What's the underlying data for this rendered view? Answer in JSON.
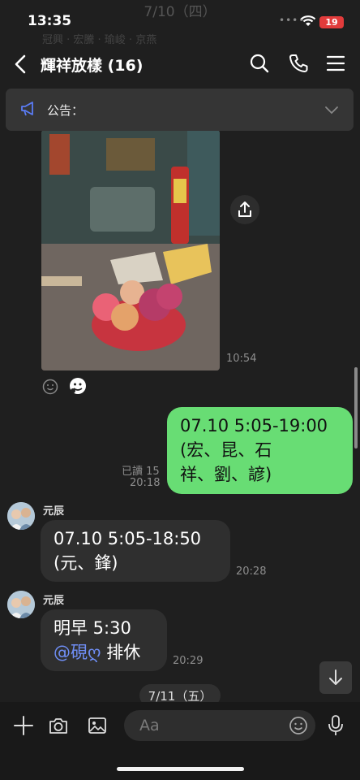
{
  "status_bar": {
    "time": "13:35",
    "battery": "19",
    "signal_dots": "••••"
  },
  "top_faded": {
    "date": "7/10（四）",
    "row": "冠興 · 宏騰 · 瑜峻 · 京燕"
  },
  "header": {
    "title": "輝祥放樣 (16)"
  },
  "announcement": {
    "label": "公告："
  },
  "photo_message": {
    "time": "10:54",
    "reactions": [
      "smile-icon",
      "reaction-sticker-icon"
    ]
  },
  "messages": [
    {
      "direction": "out",
      "lines": [
        "07.10 5:05-19:00",
        "(宏、昆、石",
        "祥、劉、諺)"
      ],
      "read": "已讀 15",
      "time": "20:18"
    },
    {
      "direction": "in",
      "sender": "元辰",
      "lines": [
        "07.10  5:05-18:50",
        "(元、鋒)"
      ],
      "time": "20:28"
    },
    {
      "direction": "in",
      "sender": "元辰",
      "line1": "明早 5:30",
      "mention": "@硯ღ",
      "line2_rest": " 排休",
      "time": "20:29"
    }
  ],
  "date_chip": "7/11（五）",
  "input": {
    "placeholder": "Aa"
  },
  "colors": {
    "background": "#1f1f1f",
    "bubble_out": "#68dd74",
    "bubble_in": "#2f2f2f",
    "mention": "#6f8ef5",
    "battery": "#e23b3b"
  }
}
